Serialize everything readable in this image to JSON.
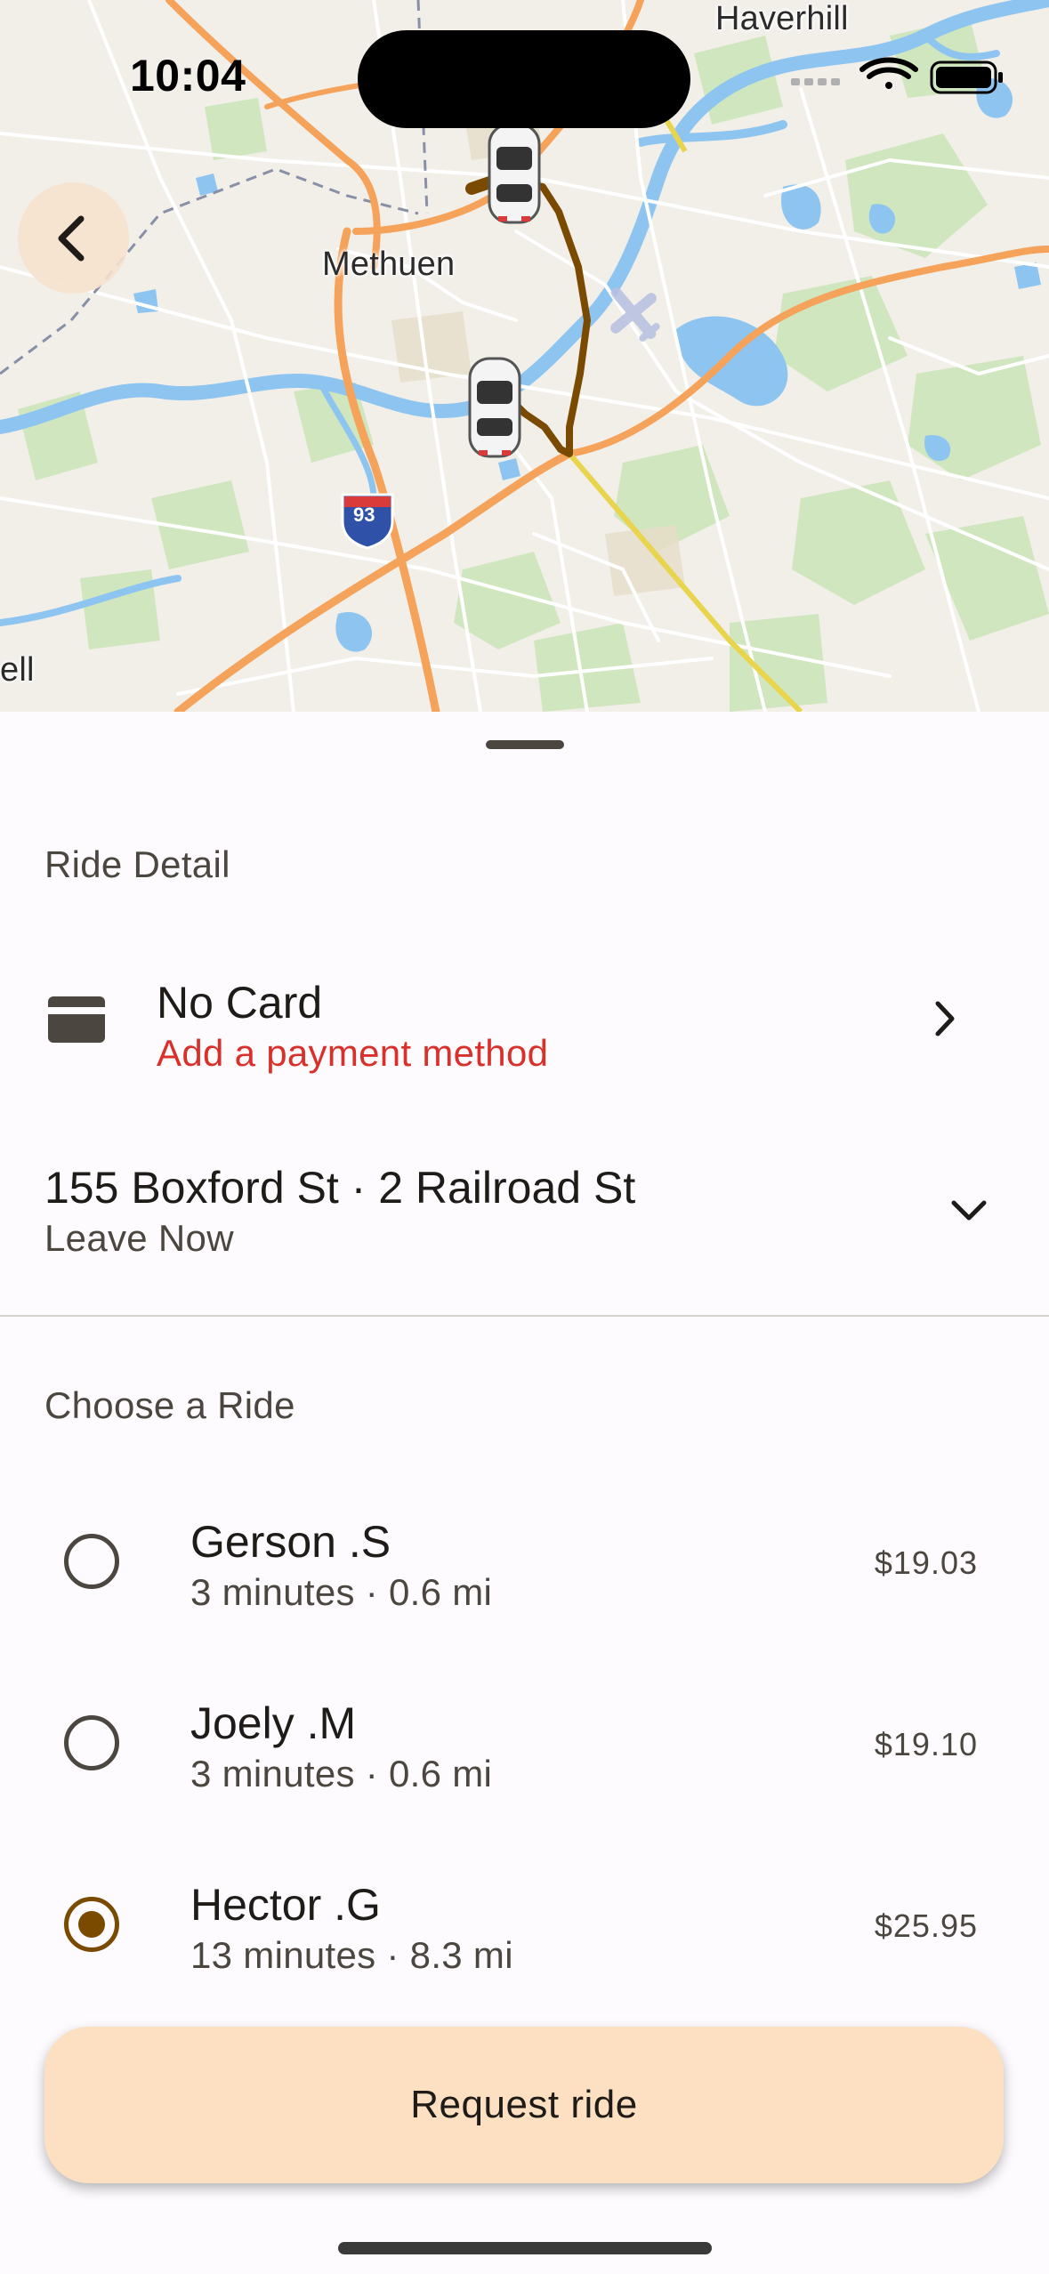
{
  "status_bar": {
    "time": "10:04",
    "wifi_icon": "wifi-icon",
    "battery_icon": "battery-icon"
  },
  "map": {
    "labels": {
      "haverhill": "Haverhill",
      "methuen": "Methuen",
      "lowell_partial": "ell",
      "interstate": "93"
    },
    "route_color": "#7a4a00"
  },
  "sheet": {
    "ride_detail_title": "Ride Detail",
    "payment": {
      "icon": "credit-card-icon",
      "title": "No Card",
      "subtitle": "Add a payment method",
      "subtitle_color": "#d9302b"
    },
    "route": {
      "title": "155 Boxford St · 2 Railroad St",
      "subtitle": "Leave Now"
    },
    "choose_title": "Choose a Ride",
    "rides": [
      {
        "name": "Gerson .S",
        "meta": "3 minutes · 0.6 mi",
        "price": "$19.03",
        "selected": false
      },
      {
        "name": "Joely .M",
        "meta": "3 minutes · 0.6 mi",
        "price": "$19.10",
        "selected": false
      },
      {
        "name": "Hector .G",
        "meta": "13 minutes · 8.3 mi",
        "price": "$25.95",
        "selected": true
      }
    ],
    "request_button": "Request ride",
    "accent_color": "#7a4a00",
    "button_color": "#fde0c1"
  }
}
